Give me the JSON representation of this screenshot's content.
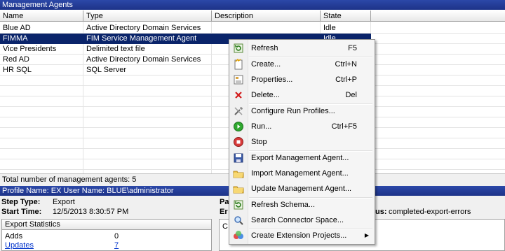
{
  "window": {
    "title": "Management Agents"
  },
  "grid": {
    "columns": [
      "Name",
      "Type",
      "Description",
      "State"
    ],
    "rows": [
      {
        "name": "Blue AD",
        "type": "Active Directory Domain Services",
        "description": "",
        "state": "Idle"
      },
      {
        "name": "FIMMA",
        "type": "FIM Service Management Agent",
        "description": "",
        "state": "Idle"
      },
      {
        "name": "Vice Presidents",
        "type": "Delimited text file",
        "description": "",
        "state": ""
      },
      {
        "name": "Red AD",
        "type": "Active Directory Domain Services",
        "description": "",
        "state": ""
      },
      {
        "name": "HR SQL",
        "type": "SQL Server",
        "description": "",
        "state": ""
      }
    ],
    "selected_row": 1
  },
  "status": {
    "text": "Total number of management agents: 5"
  },
  "profile": {
    "bar_text": "Profile Name: EX  User Name: BLUE\\administrator"
  },
  "details": {
    "step_type_label": "Step Type:",
    "step_type_value": "Export",
    "start_time_label": "Start Time:",
    "start_time_value": "12/5/2013 8:30:57 PM",
    "partial_p": "Pa",
    "partial_e": "Er",
    "status_partial_label": "us:",
    "status_value": "completed-export-errors"
  },
  "export_stats": {
    "header": "Export Statistics",
    "rows": [
      {
        "label": "Adds",
        "value": "0",
        "link": false
      },
      {
        "label": "Updates",
        "value": "7",
        "link": true
      }
    ]
  },
  "context_menu": {
    "items": [
      {
        "label": "Refresh",
        "shortcut": "F5",
        "icon": "refresh-icon"
      },
      {
        "separator": true
      },
      {
        "label": "Create...",
        "shortcut": "Ctrl+N",
        "icon": "create-icon"
      },
      {
        "label": "Properties...",
        "shortcut": "Ctrl+P",
        "icon": "properties-icon"
      },
      {
        "label": "Delete...",
        "shortcut": "Del",
        "icon": "delete-icon"
      },
      {
        "separator": true
      },
      {
        "label": "Configure Run Profiles...",
        "shortcut": "",
        "icon": "configure-icon"
      },
      {
        "label": "Run...",
        "shortcut": "Ctrl+F5",
        "icon": "run-icon"
      },
      {
        "label": "Stop",
        "shortcut": "",
        "icon": "stop-icon"
      },
      {
        "separator": true
      },
      {
        "label": "Export Management Agent...",
        "shortcut": "",
        "icon": "export-icon"
      },
      {
        "label": "Import Management Agent...",
        "shortcut": "",
        "icon": "import-icon"
      },
      {
        "label": "Update Management Agent...",
        "shortcut": "",
        "icon": "update-icon"
      },
      {
        "separator": true
      },
      {
        "label": "Refresh Schema...",
        "shortcut": "",
        "icon": "refresh-schema-icon"
      },
      {
        "label": "Search Connector Space...",
        "shortcut": "",
        "icon": "search-icon"
      },
      {
        "separator": true
      },
      {
        "label": "Create Extension Projects...",
        "shortcut": "",
        "icon": "extension-icon",
        "submenu": true
      }
    ]
  }
}
